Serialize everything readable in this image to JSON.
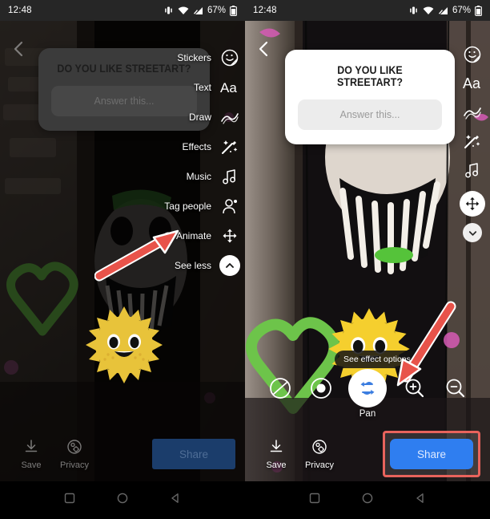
{
  "status_bar": {
    "time": "12:48",
    "battery_percent": "67%",
    "icons": [
      "vibrate-icon",
      "wifi-icon",
      "signal-icon",
      "battery-icon"
    ]
  },
  "question_sticker": {
    "title": "DO YOU LIKE STREETART?",
    "answer_placeholder": "Answer this..."
  },
  "left_panel": {
    "tools": [
      {
        "label": "Stickers",
        "icon": "sticker-icon"
      },
      {
        "label": "Text",
        "icon": "text-aa-icon"
      },
      {
        "label": "Draw",
        "icon": "draw-icon"
      },
      {
        "label": "Effects",
        "icon": "effects-wand-icon"
      },
      {
        "label": "Music",
        "icon": "music-note-icon"
      },
      {
        "label": "Tag people",
        "icon": "tag-person-icon"
      },
      {
        "label": "Animate",
        "icon": "animate-move-icon"
      },
      {
        "label": "See less",
        "icon": "chevron-up-icon"
      }
    ],
    "bottom": {
      "save_label": "Save",
      "privacy_label": "Privacy",
      "share_label": "Share"
    },
    "annotation": "red-arrow-pointing-to-animate"
  },
  "right_panel": {
    "rail_icons": [
      "sticker-icon",
      "text-aa-icon",
      "draw-icon",
      "effects-wand-icon",
      "music-note-icon",
      "animate-move-icon",
      "chevron-down-icon"
    ],
    "effect_tooltip": "See effect options",
    "effects": [
      {
        "name": "none-effect",
        "icon": "slash-circle-icon",
        "active": false
      },
      {
        "name": "dot-effect",
        "icon": "filled-dot-icon",
        "active": false
      },
      {
        "name": "pan-effect",
        "icon": "pan-arrows-icon",
        "active": true
      },
      {
        "name": "zoom-in-effect",
        "icon": "magnifier-plus-icon",
        "active": false
      },
      {
        "name": "zoom-out-effect",
        "icon": "magnifier-minus-icon",
        "active": false
      }
    ],
    "effect_selected_label": "Pan",
    "bottom": {
      "save_label": "Save",
      "privacy_label": "Privacy",
      "share_label": "Share"
    },
    "annotation": "red-arrow-pointing-to-pan-effect"
  },
  "nav_bar": {
    "buttons": [
      "recents-square-icon",
      "home-circle-icon",
      "back-triangle-icon"
    ]
  },
  "colors": {
    "share_blue": "#2f7ef0",
    "highlight_red": "#e8635c",
    "annotation_red": "#e8534a",
    "status_bar": "#262626",
    "graffiti_green": "#6dc44a"
  }
}
